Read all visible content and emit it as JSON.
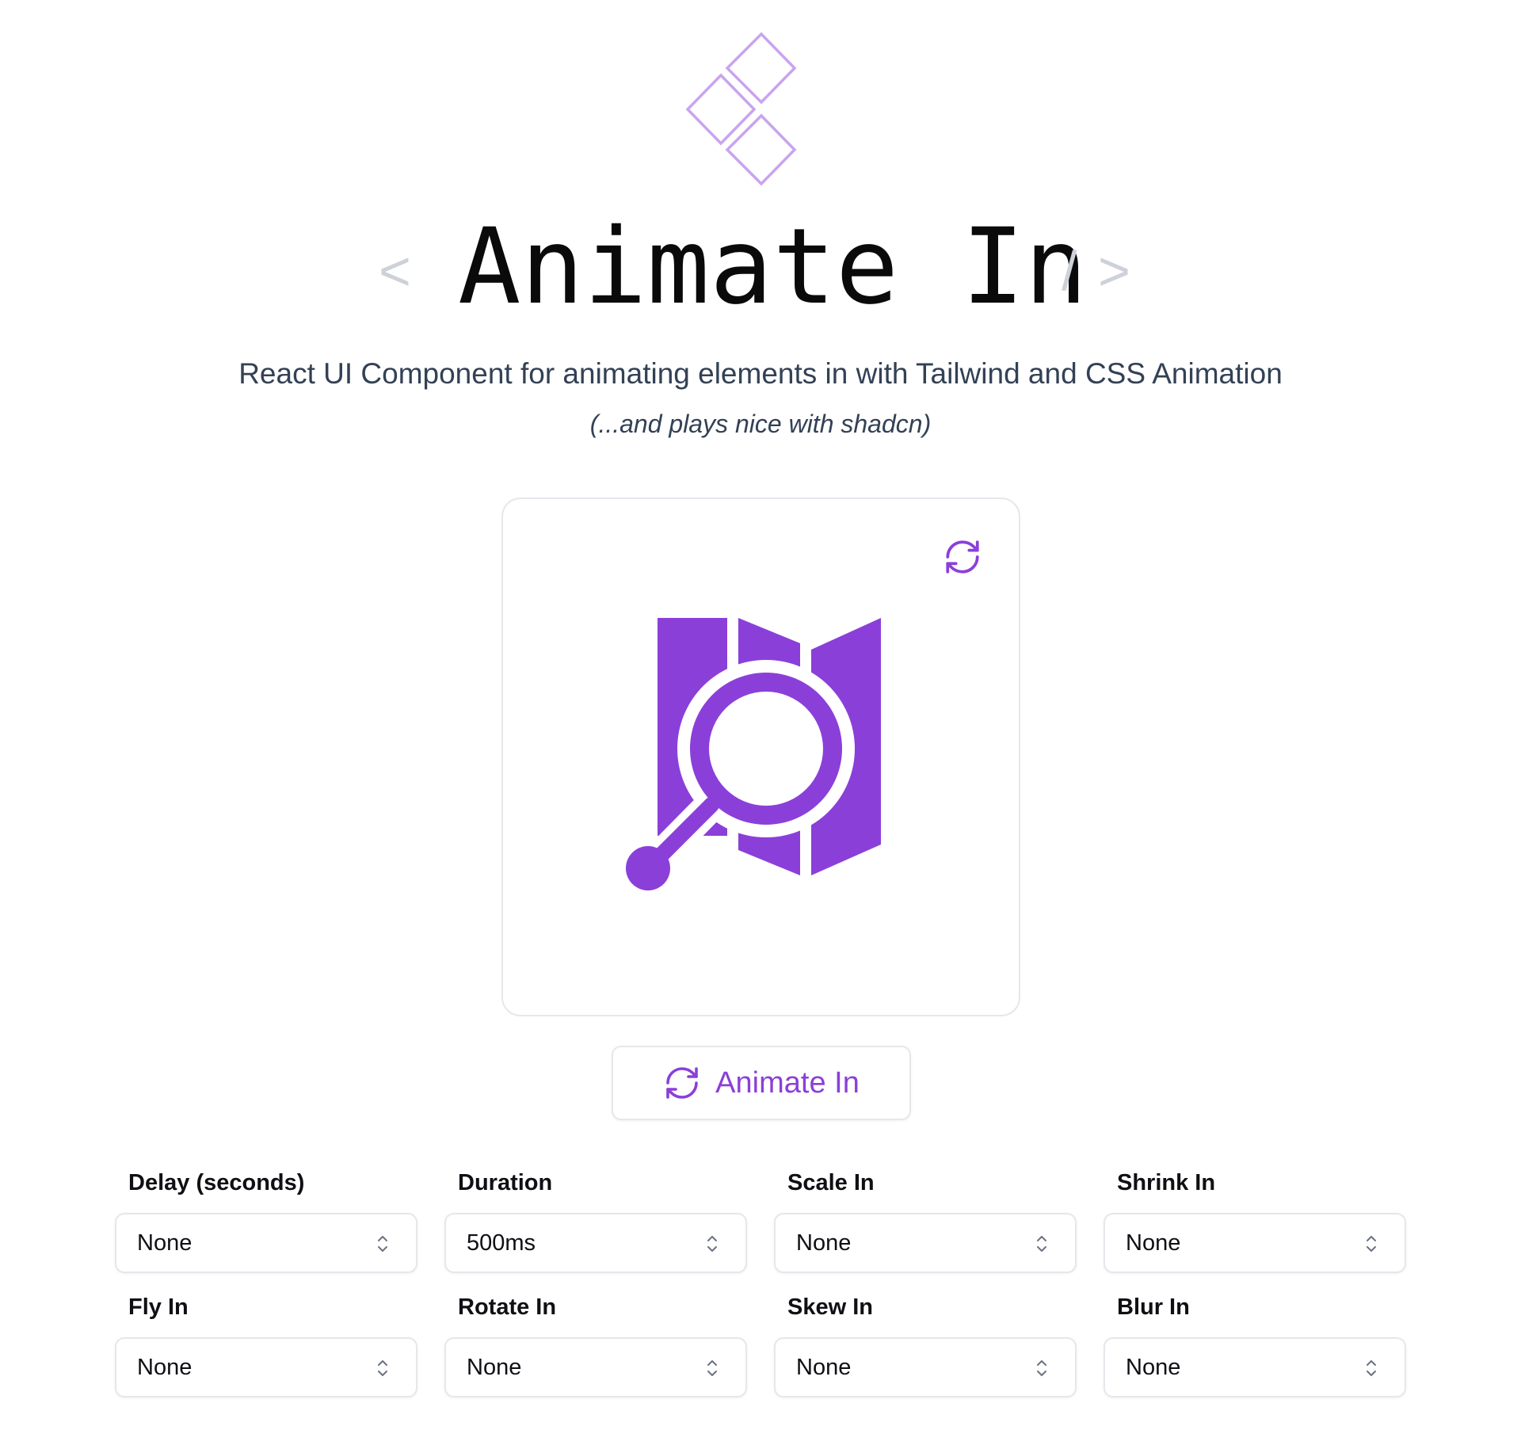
{
  "brand": {
    "logo_icon": "diamond-stack-icon",
    "accent_color": "#8b3fd9",
    "logo_color": "#c9a4ef"
  },
  "header": {
    "bracket_open": "<",
    "title": "Animate In",
    "bracket_slash": "/",
    "bracket_close": ">",
    "subtitle": "React UI Component for animating elements in with Tailwind and CSS Animation",
    "tagline": "(...and plays nice with shadcn)"
  },
  "preview": {
    "refresh_icon": "refresh-icon",
    "graphic_icon": "map-search-icon"
  },
  "animate_button": {
    "icon": "refresh-icon",
    "label": "Animate In"
  },
  "controls": [
    {
      "label": "Delay (seconds)",
      "value": "None"
    },
    {
      "label": "Duration",
      "value": "500ms"
    },
    {
      "label": "Scale In",
      "value": "None"
    },
    {
      "label": "Shrink In",
      "value": "None"
    },
    {
      "label": "Fly In",
      "value": "None"
    },
    {
      "label": "Rotate In",
      "value": "None"
    },
    {
      "label": "Skew In",
      "value": "None"
    },
    {
      "label": "Blur In",
      "value": "None"
    }
  ]
}
